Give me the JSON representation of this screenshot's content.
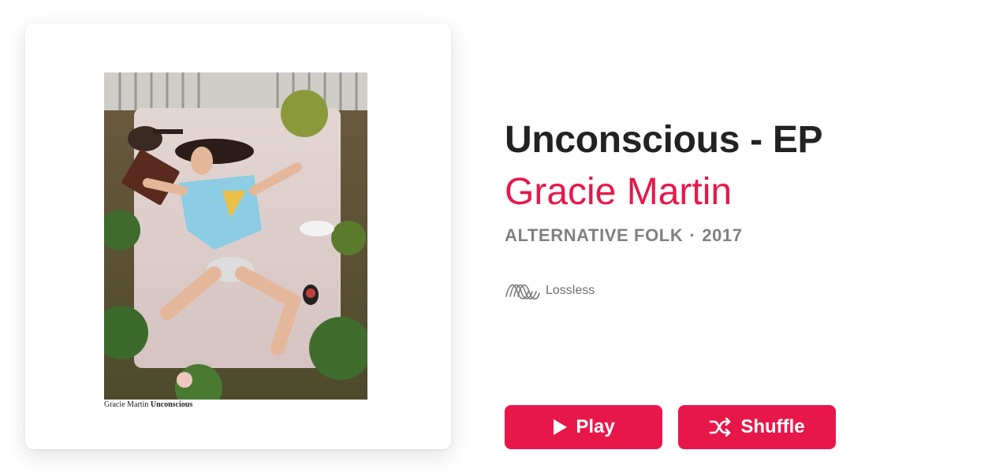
{
  "album": {
    "title": "Unconscious - EP",
    "artist": "Gracie Martin",
    "genre": "ALTERNATIVE FOLK",
    "separator": "·",
    "year": "2017",
    "quality_label": "Lossless"
  },
  "cover": {
    "caption_artist": "Gracie Martin",
    "caption_album": "Unconscious"
  },
  "actions": {
    "play_label": "Play",
    "shuffle_label": "Shuffle"
  },
  "colors": {
    "accent": "#e8174a",
    "title": "#222222",
    "meta": "#808080"
  },
  "icons": {
    "play": "play-icon",
    "shuffle": "shuffle-icon",
    "lossless": "lossless-waveform-icon"
  }
}
